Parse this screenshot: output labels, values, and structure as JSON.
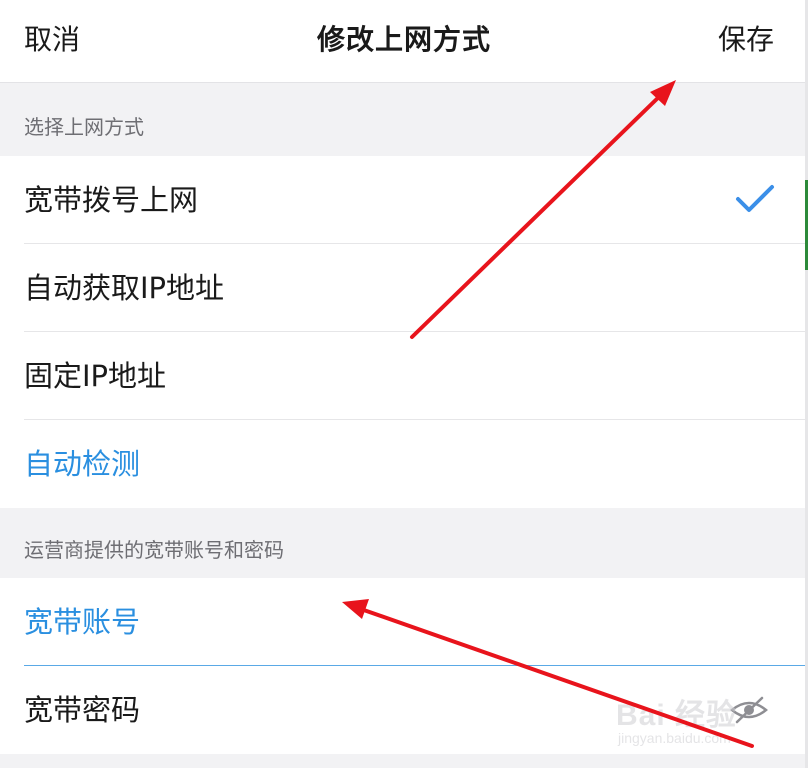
{
  "navbar": {
    "cancel_label": "取消",
    "title": "修改上网方式",
    "save_label": "保存"
  },
  "section1": {
    "header": "选择上网方式",
    "options": [
      {
        "label": "宽带拨号上网",
        "selected": true
      },
      {
        "label": "自动获取IP地址",
        "selected": false
      },
      {
        "label": "固定IP地址",
        "selected": false
      }
    ],
    "detect_label": "自动检测"
  },
  "section2": {
    "header": "运营商提供的宽带账号和密码",
    "account_label": "宽带账号",
    "password_label": "宽带密码"
  },
  "watermark": {
    "logo": "Bai 经验",
    "url": "jingyan.baidu.com"
  },
  "colors": {
    "accent_blue": "#2a8fe0",
    "check_blue": "#3b8fe8",
    "arrow_red": "#e8141c"
  },
  "icons": {
    "selected_check": "check-icon",
    "password_visibility": "eye-off-icon"
  }
}
